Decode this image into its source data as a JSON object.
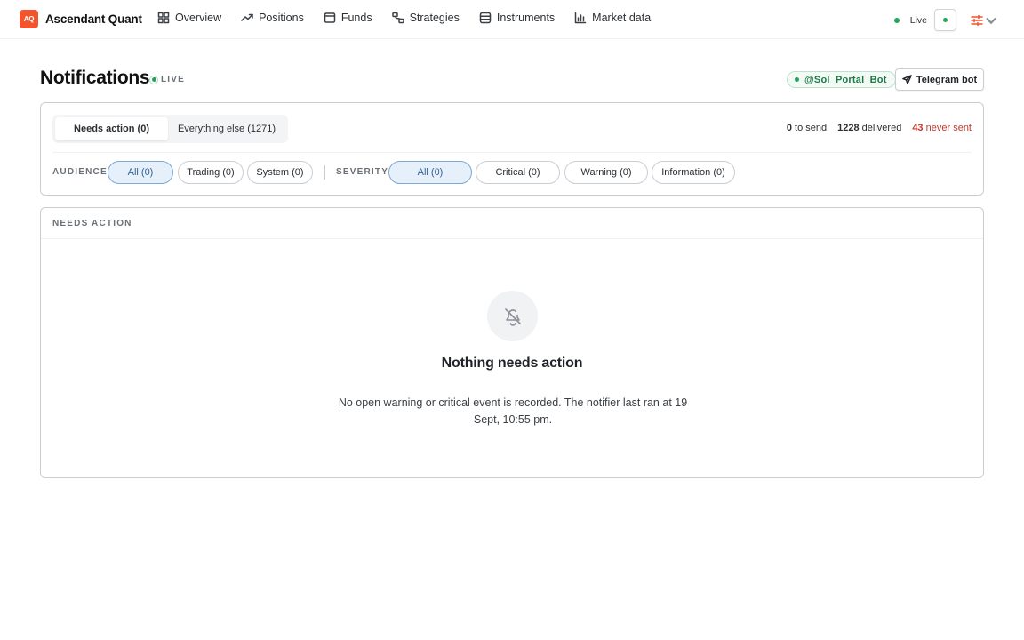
{
  "app": {
    "logo_text": "AQ",
    "name": "Ascendant Quant"
  },
  "nav": {
    "items": [
      {
        "label": "Overview",
        "icon": "grid-icon"
      },
      {
        "label": "Positions",
        "icon": "trend-up-icon"
      },
      {
        "label": "Funds",
        "icon": "wallet-icon"
      },
      {
        "label": "Strategies",
        "icon": "strategy-icon"
      },
      {
        "label": "Instruments",
        "icon": "database-icon"
      },
      {
        "label": "Market data",
        "icon": "chart-icon"
      }
    ]
  },
  "status": {
    "label": "Live"
  },
  "header": {
    "title": "Notifications",
    "live_tag": "LIVE",
    "bot_handle": "@Sol_Portal_Bot",
    "telegram_button": "Telegram bot"
  },
  "tabs": {
    "needs_action": "Needs action (0)",
    "everything_else": "Everything else (1271)"
  },
  "counts": {
    "to_send_num": "0",
    "to_send_label": "to send",
    "delivered_num": "1228",
    "delivered_label": "delivered",
    "never_sent_num": "43",
    "never_sent_label": "never sent"
  },
  "filters": {
    "audience_label": "AUDIENCE",
    "audience": [
      "All (0)",
      "Trading (0)",
      "System (0)"
    ],
    "severity_label": "SEVERITY",
    "severity": [
      "All (0)",
      "Critical (0)",
      "Warning (0)",
      "Information (0)"
    ]
  },
  "needs_action": {
    "heading": "NEEDS ACTION",
    "empty_title": "Nothing needs action",
    "empty_desc": "No open warning or critical event is recorded. The notifier last ran at 19 Sept, 10:55 pm."
  },
  "colors": {
    "brand": "#f2542d",
    "live_green": "#22a35a",
    "danger_red": "#c0392b",
    "active_chip": "#e6f0fb"
  }
}
